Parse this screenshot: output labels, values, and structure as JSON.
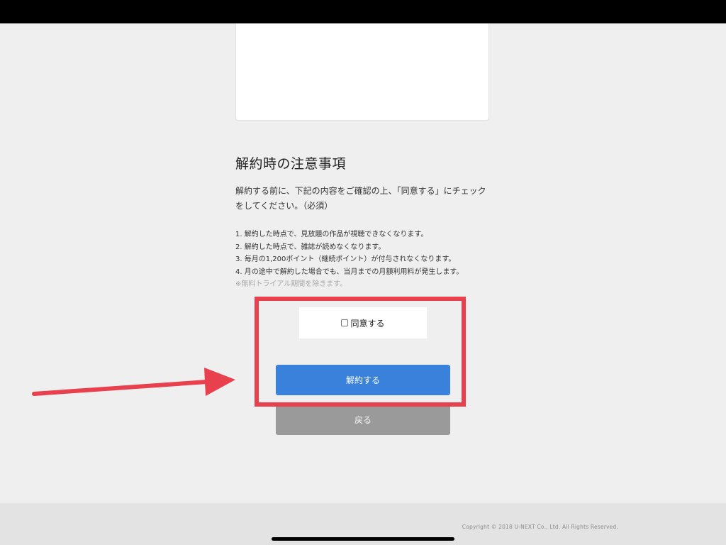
{
  "notice": {
    "title": "解約時の注意事項",
    "intro": "解約する前に、下記の内容をご確認の上、「同意する」にチェックをしてください。（必須）",
    "items": [
      "1. 解約した時点で、見放題の作品が視聴できなくなります。",
      "2. 解約した時点で、雑誌が読めなくなります。",
      "3. 毎月の1,200ポイント（継続ポイント）が付与されなくなります。",
      "4. 月の途中で解約した場合でも、当月までの月額利用料が発生します。"
    ],
    "note": "※無料トライアル期間を除きます。"
  },
  "agree": {
    "label": "同意する",
    "checked": false
  },
  "buttons": {
    "cancel_label": "解約する",
    "back_label": "戻る"
  },
  "footer": {
    "copyright": "Copyright © 2018 U-NEXT Co., Ltd. All Rights Reserved."
  },
  "colors": {
    "highlight": "#e8404c",
    "primary_button": "#3a81dc",
    "secondary_button": "#9a9a9a",
    "background": "#efefef"
  }
}
